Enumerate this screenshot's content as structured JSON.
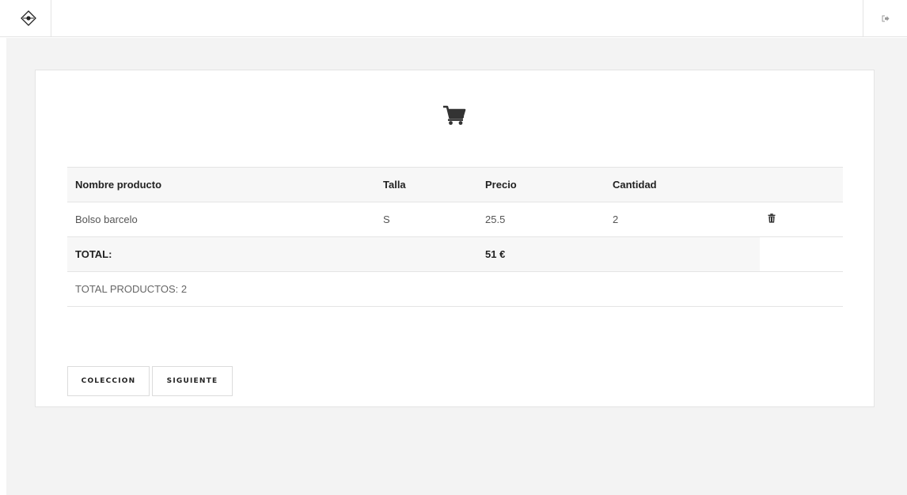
{
  "header": {
    "logo_icon": "diamond-dot-icon",
    "logout_icon": "sign-out-icon"
  },
  "cart": {
    "icon": "shopping-cart-icon",
    "columns": [
      "Nombre producto",
      "Talla",
      "Precio",
      "Cantidad",
      ""
    ],
    "items": [
      {
        "name": "Bolso barcelo",
        "size": "S",
        "price": "25.5",
        "quantity": "2",
        "action_icon": "trash-icon"
      }
    ],
    "total_label": "TOTAL:",
    "total_value": "51 €",
    "products_count_label": "TOTAL PRODUCTOS: 2"
  },
  "actions": {
    "coleccion_label": "COLECCION",
    "siguiente_label": "SIGUIENTE"
  },
  "colors": {
    "background": "#f3f3f3",
    "card": "#ffffff",
    "header_row": "#f7f7f7",
    "border": "#e4e4e4",
    "text": "#222222"
  }
}
